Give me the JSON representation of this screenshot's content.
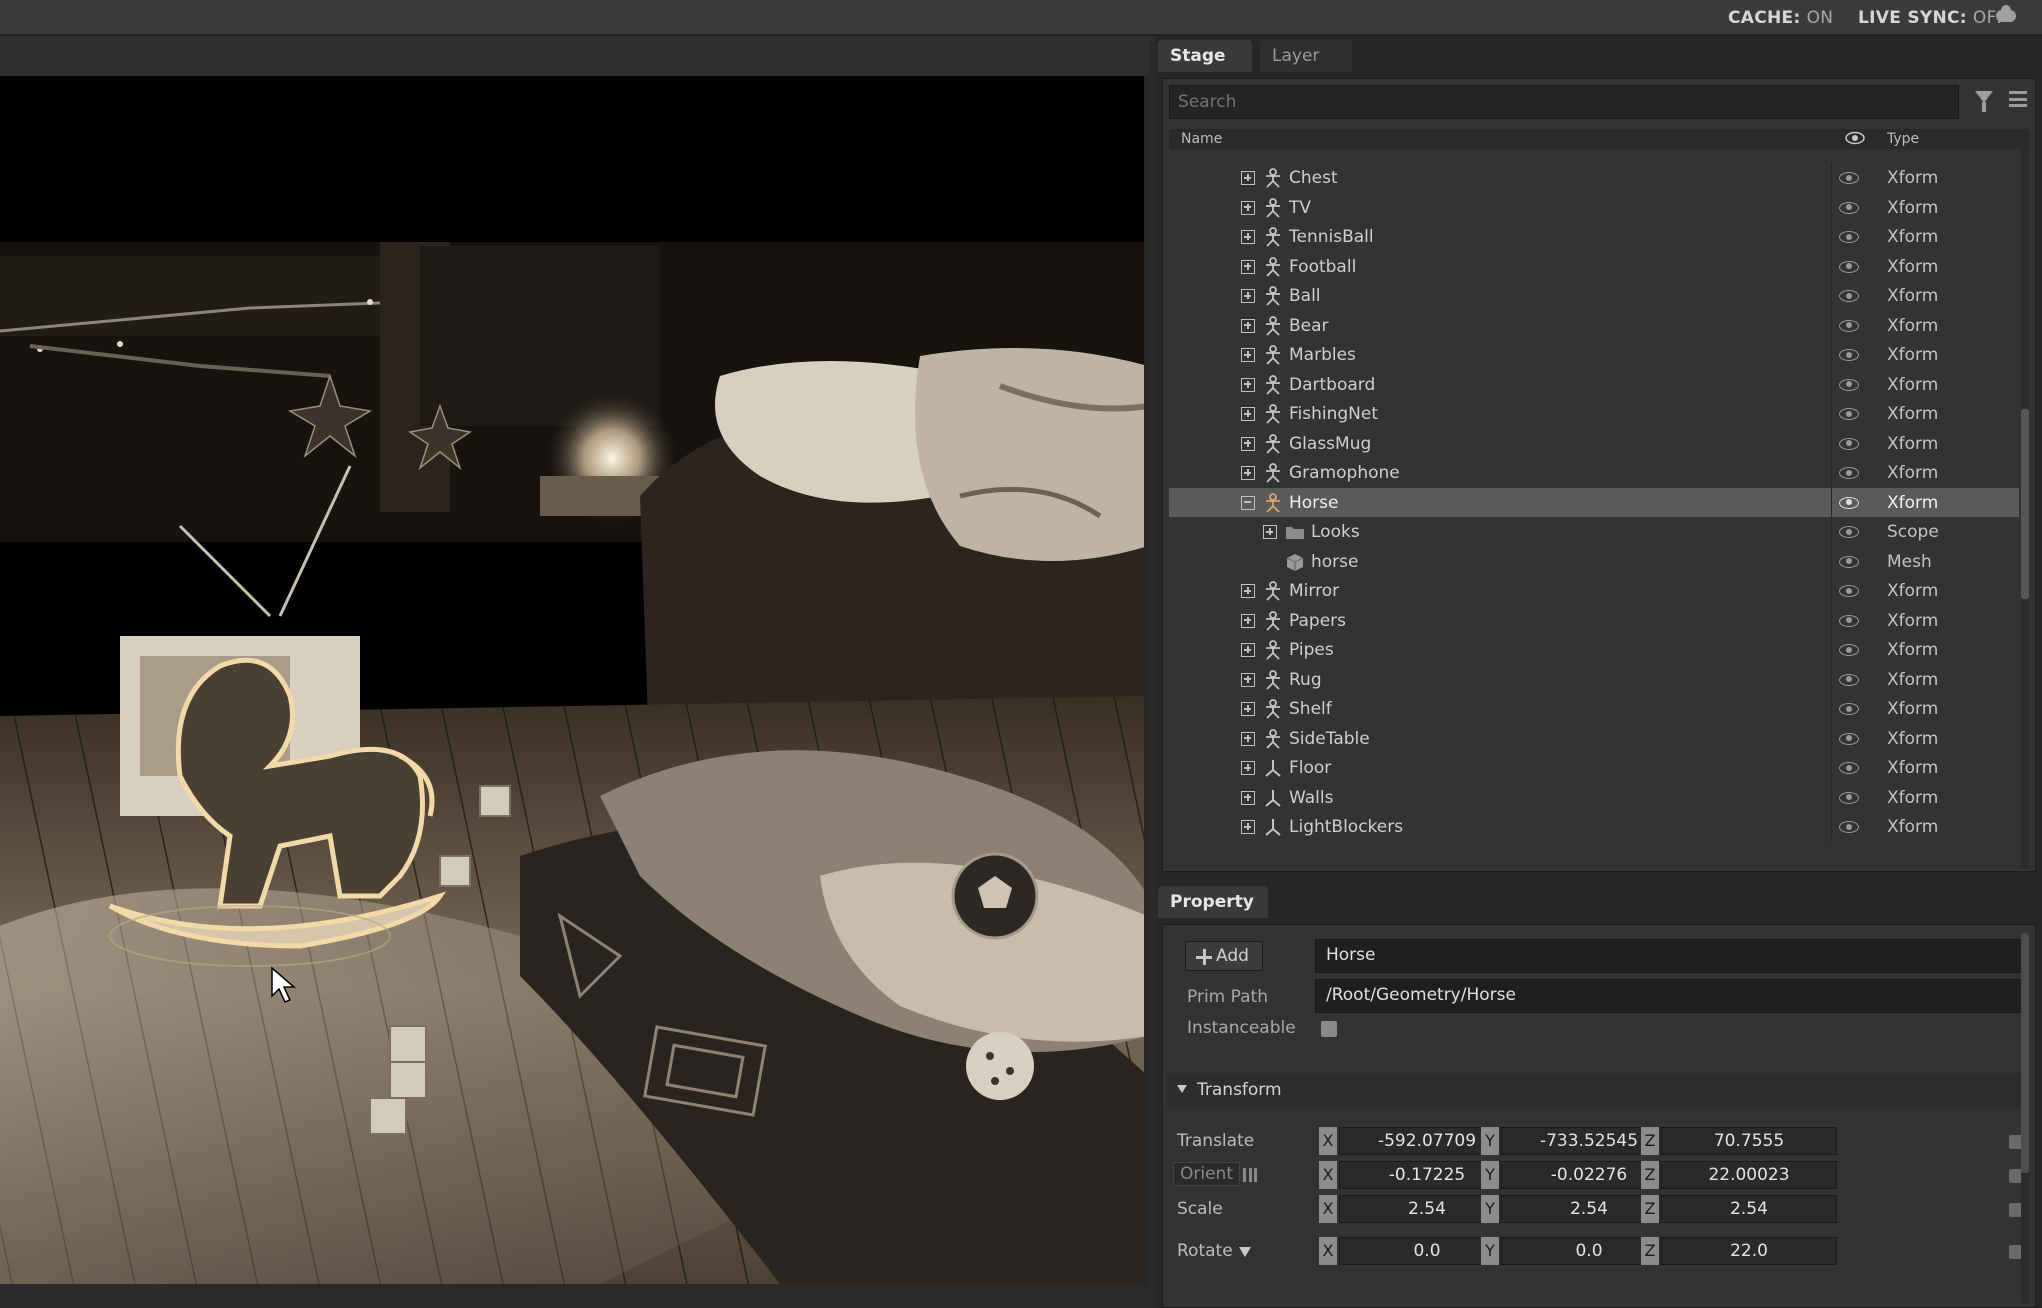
{
  "statusbar": {
    "cache_label": "CACHE:",
    "cache_value": "ON",
    "livesync_label": "LIVE SYNC:",
    "livesync_value": "OFF"
  },
  "stage_panel": {
    "tabs": [
      {
        "label": "Stage",
        "active": true
      },
      {
        "label": "Layer",
        "active": false
      }
    ],
    "search_placeholder": "Search",
    "columns": {
      "name": "Name",
      "type": "Type"
    },
    "rows": [
      {
        "label": "Chest",
        "type": "Xform",
        "indent": 1,
        "icon": "xform-figure-icon",
        "expander": "plus",
        "selected": false
      },
      {
        "label": "TV",
        "type": "Xform",
        "indent": 1,
        "icon": "xform-figure-icon",
        "expander": "plus",
        "selected": false
      },
      {
        "label": "TennisBall",
        "type": "Xform",
        "indent": 1,
        "icon": "xform-figure-icon",
        "expander": "plus",
        "selected": false
      },
      {
        "label": "Football",
        "type": "Xform",
        "indent": 1,
        "icon": "xform-figure-icon",
        "expander": "plus",
        "selected": false
      },
      {
        "label": "Ball",
        "type": "Xform",
        "indent": 1,
        "icon": "xform-figure-icon",
        "expander": "plus",
        "selected": false
      },
      {
        "label": "Bear",
        "type": "Xform",
        "indent": 1,
        "icon": "xform-figure-icon",
        "expander": "plus",
        "selected": false
      },
      {
        "label": "Marbles",
        "type": "Xform",
        "indent": 1,
        "icon": "xform-figure-icon",
        "expander": "plus",
        "selected": false
      },
      {
        "label": "Dartboard",
        "type": "Xform",
        "indent": 1,
        "icon": "xform-figure-icon",
        "expander": "plus",
        "selected": false
      },
      {
        "label": "FishingNet",
        "type": "Xform",
        "indent": 1,
        "icon": "xform-figure-icon",
        "expander": "plus",
        "selected": false
      },
      {
        "label": "GlassMug",
        "type": "Xform",
        "indent": 1,
        "icon": "xform-figure-icon",
        "expander": "plus",
        "selected": false
      },
      {
        "label": "Gramophone",
        "type": "Xform",
        "indent": 1,
        "icon": "xform-figure-icon",
        "expander": "plus",
        "selected": false
      },
      {
        "label": "Horse",
        "type": "Xform",
        "indent": 1,
        "icon": "xform-figure-icon",
        "expander": "minus",
        "selected": true
      },
      {
        "label": "Looks",
        "type": "Scope",
        "indent": 2,
        "icon": "folder-icon",
        "expander": "plus",
        "selected": false
      },
      {
        "label": "horse",
        "type": "Mesh",
        "indent": 2,
        "icon": "mesh-cube-icon",
        "expander": "none",
        "selected": false
      },
      {
        "label": "Mirror",
        "type": "Xform",
        "indent": 1,
        "icon": "xform-figure-icon",
        "expander": "plus",
        "selected": false
      },
      {
        "label": "Papers",
        "type": "Xform",
        "indent": 1,
        "icon": "xform-figure-icon",
        "expander": "plus",
        "selected": false
      },
      {
        "label": "Pipes",
        "type": "Xform",
        "indent": 1,
        "icon": "xform-figure-icon",
        "expander": "plus",
        "selected": false
      },
      {
        "label": "Rug",
        "type": "Xform",
        "indent": 1,
        "icon": "xform-figure-icon",
        "expander": "plus",
        "selected": false
      },
      {
        "label": "Shelf",
        "type": "Xform",
        "indent": 1,
        "icon": "xform-figure-icon",
        "expander": "plus",
        "selected": false
      },
      {
        "label": "SideTable",
        "type": "Xform",
        "indent": 1,
        "icon": "xform-figure-icon",
        "expander": "plus",
        "selected": false
      },
      {
        "label": "Floor",
        "type": "Xform",
        "indent": 1,
        "icon": "xform-axis-icon",
        "expander": "plus",
        "selected": false
      },
      {
        "label": "Walls",
        "type": "Xform",
        "indent": 1,
        "icon": "xform-axis-icon",
        "expander": "plus",
        "selected": false
      },
      {
        "label": "LightBlockers",
        "type": "Xform",
        "indent": 1,
        "icon": "xform-axis-icon",
        "expander": "plus",
        "selected": false
      }
    ]
  },
  "property_panel": {
    "tab": "Property",
    "add_label": "Add",
    "name_value": "Horse",
    "prim_path_label": "Prim Path",
    "prim_path_value": "/Root/Geometry/Horse",
    "instanceable_label": "Instanceable",
    "instanceable_checked": false,
    "transform_section": "Transform",
    "transform_rows": [
      {
        "label": "Translate",
        "x": "-592.07709",
        "y": "-733.52545",
        "z": "70.7555"
      },
      {
        "label": "Orient",
        "x": "-0.17225",
        "y": "-0.02276",
        "z": "22.00023"
      },
      {
        "label": "Scale",
        "x": "2.54",
        "y": "2.54",
        "z": "2.54"
      },
      {
        "label": "Rotate",
        "x": "0.0",
        "y": "0.0",
        "z": "22.0"
      }
    ],
    "axis_letters": [
      "X",
      "Y",
      "Z"
    ]
  },
  "colors": {
    "panel_bg": "#333333",
    "selected_row": "#5a5a5a",
    "viewport_bg": "#000000",
    "field_bg": "#1f1f1f"
  }
}
